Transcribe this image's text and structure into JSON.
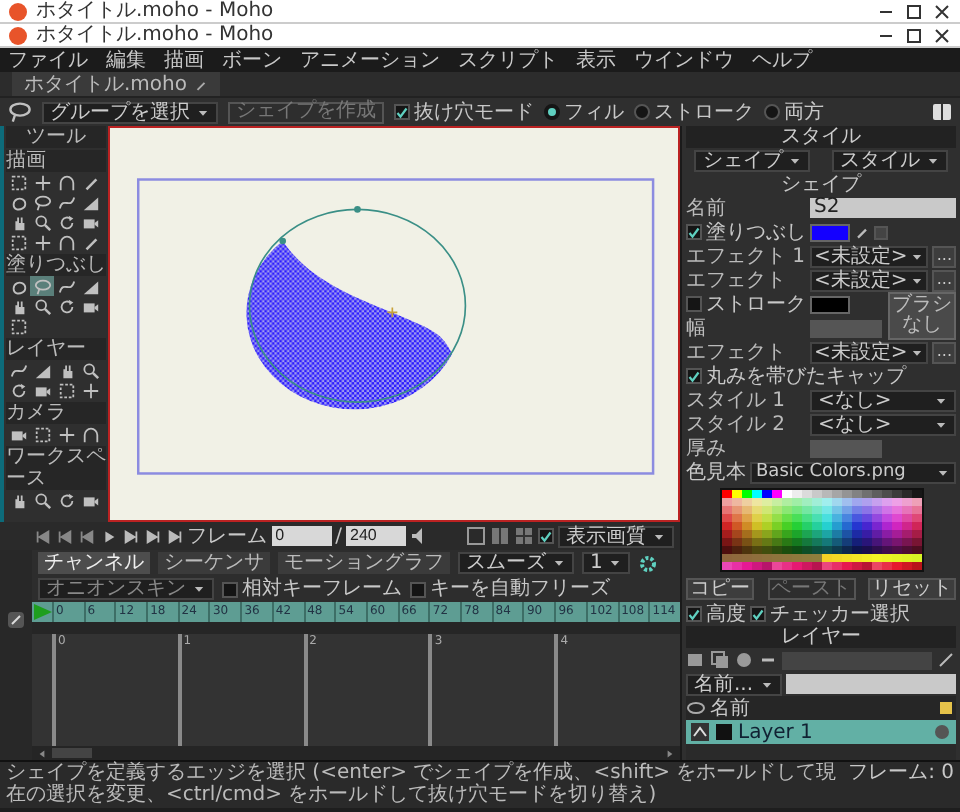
{
  "windows": [
    {
      "title": "ホタイトル.moho - Moho"
    },
    {
      "title": "ホタイトル.moho - Moho"
    }
  ],
  "menu": [
    "ファイル",
    "編集",
    "描画",
    "ボーン",
    "アニメーション",
    "スクリプト",
    "表示",
    "ウインドウ",
    "ヘルプ"
  ],
  "document_tab": {
    "label": "ホタイトル.moho"
  },
  "toolbar": {
    "select_group": "グループを選択",
    "create_shape": {
      "label": "シェイプを作成",
      "disabled": true
    },
    "hole_mode": {
      "label": "抜け穴モード",
      "checked": true
    },
    "modes": [
      {
        "label": "フィル",
        "selected": true
      },
      {
        "label": "ストローク",
        "selected": false
      },
      {
        "label": "両方",
        "selected": false
      }
    ]
  },
  "tools": {
    "title": "ツール",
    "sections": [
      {
        "label": "描画",
        "tools": [
          {
            "selected": false
          },
          {
            "selected": false
          },
          {
            "selected": false
          },
          {
            "selected": false
          },
          {
            "selected": false
          },
          {
            "selected": false
          },
          {
            "selected": false
          },
          {
            "selected": false
          },
          {
            "selected": false
          },
          {
            "selected": false
          },
          {
            "selected": false
          },
          {
            "selected": false
          },
          {
            "selected": false
          },
          {
            "selected": false
          },
          {
            "selected": false
          },
          {
            "selected": false
          }
        ]
      },
      {
        "label": "塗りつぶし",
        "tools": [
          {
            "selected": false
          },
          {
            "selected": true
          },
          {
            "selected": false
          },
          {
            "selected": false
          },
          {
            "selected": false
          },
          {
            "selected": false
          },
          {
            "selected": false
          },
          {
            "selected": false
          },
          {
            "selected": false
          }
        ]
      },
      {
        "label": "レイヤー",
        "tools": [
          {
            "selected": false
          },
          {
            "selected": false
          },
          {
            "selected": false
          },
          {
            "selected": false
          },
          {
            "selected": false
          },
          {
            "selected": false
          },
          {
            "selected": false
          },
          {
            "selected": false
          }
        ]
      },
      {
        "label": "カメラ",
        "tools": [
          {
            "selected": false
          },
          {
            "selected": false
          },
          {
            "selected": false
          },
          {
            "selected": false
          }
        ]
      },
      {
        "label": "ワークスペース",
        "tools": [
          {
            "selected": false
          },
          {
            "selected": false
          },
          {
            "selected": false
          },
          {
            "selected": false
          }
        ]
      }
    ]
  },
  "style_panel": {
    "title": "スタイル",
    "dropdowns": [
      "シェイプ",
      "スタイル"
    ],
    "section": "シェイプ",
    "name": {
      "label": "名前",
      "value": "S2"
    },
    "fill": {
      "label": "塗りつぶし",
      "checked": true,
      "color": "#1400ff"
    },
    "fill_effects": [
      {
        "label": "エフェクト 1",
        "value": "<未設定>"
      },
      {
        "label": "エフェクト",
        "value": "<未設定>"
      }
    ],
    "stroke": {
      "label": "ストローク",
      "checked": false,
      "color": "#000000"
    },
    "more_buttons": [
      "...",
      "...",
      "..."
    ],
    "brush_button": "ブラシなし",
    "width_label": "幅",
    "stroke_effect": {
      "label": "エフェクト",
      "value": "<未設定>"
    },
    "round_caps": {
      "label": "丸みを帯びたキャップ",
      "checked": true
    },
    "styles": [
      {
        "label": "スタイル 1",
        "value": "<なし>"
      },
      {
        "label": "スタイル 2",
        "value": "<なし>"
      }
    ],
    "thickness_label": "厚み",
    "swatches": {
      "label": "色見本",
      "value": "Basic Colors.png"
    },
    "buttons": [
      {
        "label": "コピー",
        "disabled": false
      },
      {
        "label": "ペースト",
        "disabled": true
      },
      {
        "label": "リセット",
        "disabled": false
      }
    ],
    "options": [
      {
        "label": "高度",
        "checked": true
      },
      {
        "label": "チェッカー選択",
        "checked": true
      }
    ]
  },
  "layers": {
    "title": "レイヤー",
    "sort": "名前...",
    "column_name": "名前",
    "layers": [
      {
        "name": "Layer 1",
        "selected": true
      }
    ]
  },
  "playback": {
    "frame_label": "フレーム",
    "frame": "0",
    "separator": "/",
    "total": "240",
    "quality": "表示画質",
    "show_checked": true
  },
  "timeline": {
    "tabs": [
      {
        "label": "チャンネル",
        "selected": true
      },
      {
        "label": "シーケンサ",
        "selected": false
      },
      {
        "label": "モーショングラフ",
        "selected": false
      }
    ],
    "interpolation": "スムーズ",
    "interval": "1",
    "onion_skin": "オニオンスキン",
    "relative_keyframes": {
      "label": "相対キーフレーム",
      "checked": false
    },
    "auto_freeze": {
      "label": "キーを自動フリーズ",
      "checked": false
    },
    "ruler": [
      "0",
      "6",
      "12",
      "18",
      "24",
      "30",
      "36",
      "42",
      "48",
      "54",
      "60",
      "66",
      "72",
      "78",
      "84",
      "90",
      "96",
      "102",
      "108",
      "114"
    ],
    "seconds": [
      "0",
      "1",
      "2",
      "3",
      "4"
    ]
  },
  "status_bar": {
    "hint": "シェイプを定義するエッジを選択 (<enter> でシェイプを作成、<shift> をホールドして現在の選択を変更、<ctrl/cmd> をホールドして抜け穴モードを切り替え)",
    "frame": "フレーム: 0"
  }
}
